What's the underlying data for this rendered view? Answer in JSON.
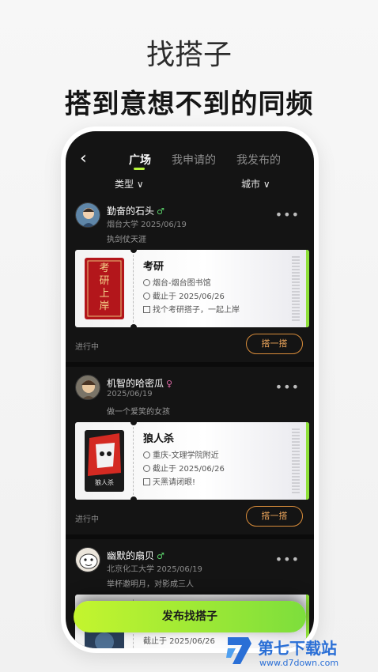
{
  "headline": {
    "title": "找搭子",
    "subtitle": "搭到意想不到的同频"
  },
  "topbar": {
    "back_icon": "chevron-left-icon",
    "tabs": [
      {
        "label": "广场",
        "active": true
      },
      {
        "label": "我申请的",
        "active": false
      },
      {
        "label": "我发布的",
        "active": false
      }
    ]
  },
  "filters": {
    "type_label": "类型 ∨",
    "city_label": "城市 ∨"
  },
  "posts": [
    {
      "username": "勤奋的石头",
      "gender": "♂",
      "school_date": "烟台大学  2025/06/19",
      "bio": "执剑仗天涯",
      "ticket": {
        "cover_text": "考研上岸",
        "title": "考研",
        "location": "烟台-烟台图书馆",
        "deadline": "截止于 2025/06/26",
        "desc": "找个考研搭子，一起上岸"
      },
      "status": "进行中",
      "button": "搭一搭"
    },
    {
      "username": "机智的哈密瓜",
      "gender": "♀",
      "school_date": "2025/06/19",
      "bio": "做一个爱笑的女孩",
      "ticket": {
        "cover_text": "狼人杀",
        "title": "狼人杀",
        "location": "重庆-文理学院附近",
        "deadline": "截止于 2025/06/26",
        "desc": "天黑请闭眼!"
      },
      "status": "进行中",
      "button": "搭一搭"
    },
    {
      "username": "幽默的扇贝",
      "gender": "♂",
      "school_date": "北京化工大学  2025/06/19",
      "bio": "举杯邀明月，对影成三人",
      "ticket": {
        "deadline": "截止于 2025/06/26"
      }
    }
  ],
  "publish_button": "发布找搭子",
  "watermark": {
    "title": "第七下载站",
    "url": "www.d7down.com"
  },
  "colors": {
    "accent": "#b7f53a",
    "button_outline": "#d88c3a",
    "male": "#5bd36b",
    "female": "#e26aa8"
  }
}
